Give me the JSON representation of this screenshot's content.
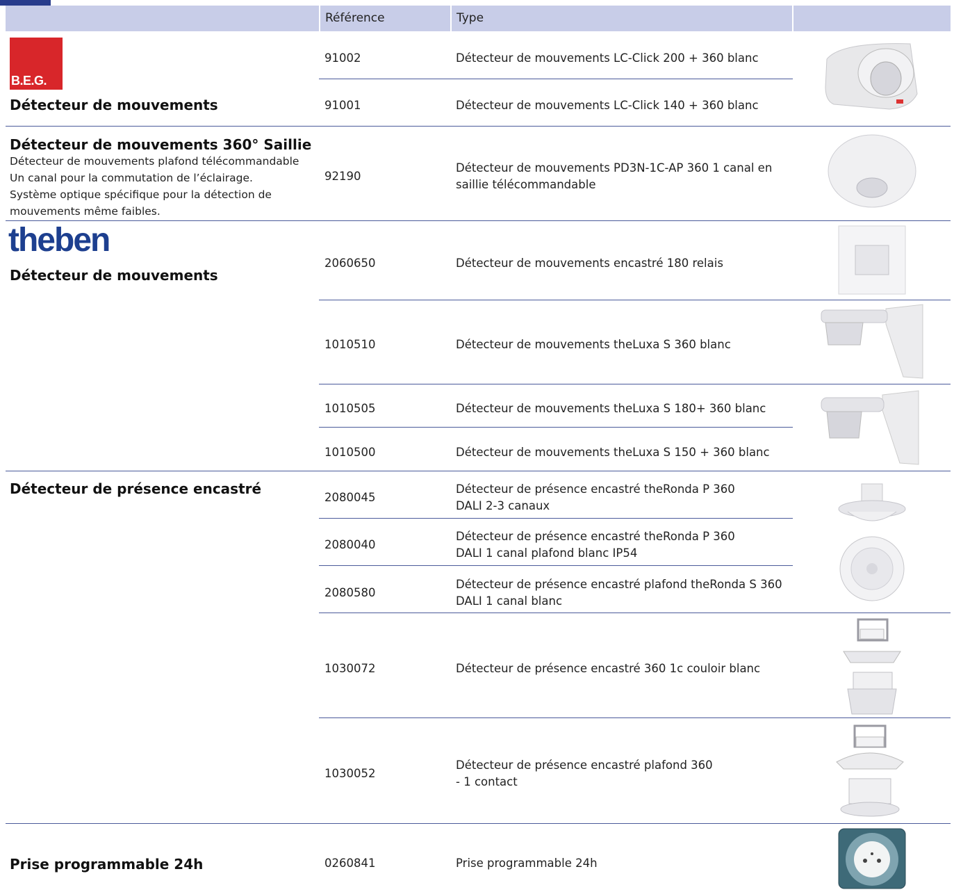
{
  "header": {
    "col_reference": "Référence",
    "col_type": "Type"
  },
  "brands": {
    "beg": "B.E.G.",
    "theben": "theben"
  },
  "sections": [
    {
      "title": "Détecteur de mouvements"
    },
    {
      "title": "Détecteur de mouvements 360° Saillie",
      "description": [
        "Détecteur de mouvements plafond télécommandable",
        "Un canal pour la commutation de l’éclairage.",
        "Système optique spécifique pour la détection de",
        "mouvements même faibles."
      ]
    },
    {
      "title": "Détecteur de mouvements"
    },
    {
      "title": "Détecteur de présence encastré"
    },
    {
      "title": "Prise programmable 24h"
    }
  ],
  "rows": [
    {
      "ref": "91002",
      "type": [
        "Détecteur de mouvements LC-Click 200 + 360 blanc"
      ]
    },
    {
      "ref": "91001",
      "type": [
        "Détecteur de mouvements LC-Click 140 + 360 blanc"
      ]
    },
    {
      "ref": "92190",
      "type": [
        "Détecteur de mouvements PD3N-1C-AP 360 1 canal en",
        "saillie télécommandable"
      ]
    },
    {
      "ref": "2060650",
      "type": [
        "Détecteur de mouvements encastré 180 relais"
      ]
    },
    {
      "ref": "1010510",
      "type": [
        "Détecteur de mouvements theLuxa S 360 blanc"
      ]
    },
    {
      "ref": "1010505",
      "type": [
        "Détecteur de mouvements theLuxa S 180+ 360 blanc"
      ]
    },
    {
      "ref": "1010500",
      "type": [
        "Détecteur de mouvements theLuxa S 150 + 360 blanc"
      ]
    },
    {
      "ref": "2080045",
      "type": [
        "Détecteur de présence encastré theRonda P 360",
        "DALI 2-3 canaux"
      ]
    },
    {
      "ref": "2080040",
      "type": [
        "Détecteur de présence encastré theRonda P 360",
        "DALI 1 canal plafond blanc IP54"
      ]
    },
    {
      "ref": "2080580",
      "type": [
        "Détecteur de présence encastré plafond theRonda S 360",
        "DALI 1 canal blanc"
      ]
    },
    {
      "ref": "1030072",
      "type": [
        "Détecteur de présence encastré 360 1c couloir blanc"
      ]
    },
    {
      "ref": "1030052",
      "type": [
        "Détecteur de présence encastré plafond 360",
        "- 1 contact"
      ]
    },
    {
      "ref": "0260841",
      "type": [
        "Prise programmable 24h"
      ]
    }
  ],
  "colors": {
    "header_bg": "#c8cde8",
    "rule": "#4a5a9a",
    "beg_red": "#d8262a",
    "theben_blue": "#1d3f8f",
    "corner_tab": "#283c8c"
  }
}
